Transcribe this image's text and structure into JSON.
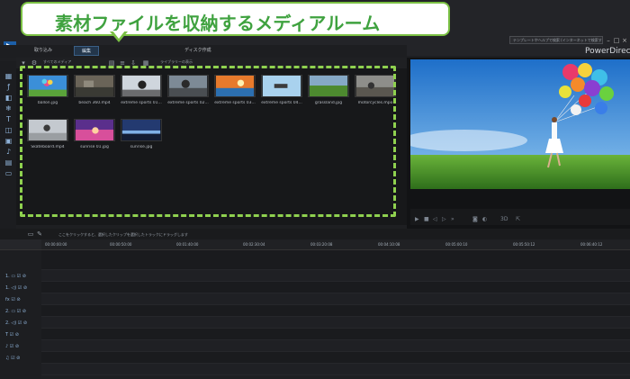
{
  "banner": {
    "text": "素材ファイルを収納するメディアルーム"
  },
  "app": {
    "name": "PowerDirector"
  },
  "modes": [
    {
      "label": "取り込み"
    },
    {
      "label": "編集"
    },
    {
      "label": "ディスク作成"
    }
  ],
  "search": {
    "placeholder": "テンプレートやヘルプで検索 (インターネットで検索する)"
  },
  "library": {
    "filter_all": "すべてのメディア",
    "filter_sort": "ライブラリーの表示",
    "items": [
      {
        "name": "ballon.jpg"
      },
      {
        "name": "beach 360.mp4"
      },
      {
        "name": "extreme sports 01..."
      },
      {
        "name": "extreme sports 02..."
      },
      {
        "name": "extreme sports 03..."
      },
      {
        "name": "extreme sports 04..."
      },
      {
        "name": "grassland.jpg"
      },
      {
        "name": "motorcycles.mpo"
      },
      {
        "name": "Skateboard.mp4"
      },
      {
        "name": "sunrise 01.jpg"
      },
      {
        "name": "sunrise.jpg"
      }
    ]
  },
  "status": {
    "hint": "ここをクリックすると、選択したクリップを選択したトラックにドラッグします"
  },
  "timeline": {
    "ticks": [
      "00:00:00:00",
      "00:00:50:00",
      "00:01:40:00",
      "00:02:30:04",
      "00:03:20:08",
      "00:04:10:08",
      "00:05:00:10",
      "00:05:50:12",
      "00:06:40:12"
    ],
    "track_labels": [
      "1.",
      "1.",
      "fx",
      "2.",
      "2.",
      "T",
      "",
      ""
    ]
  },
  "preview": {
    "format_label": "3D"
  },
  "colors": {
    "accent": "#7ac043",
    "highlight": "#8fd14f",
    "title": "#3fa23f"
  }
}
